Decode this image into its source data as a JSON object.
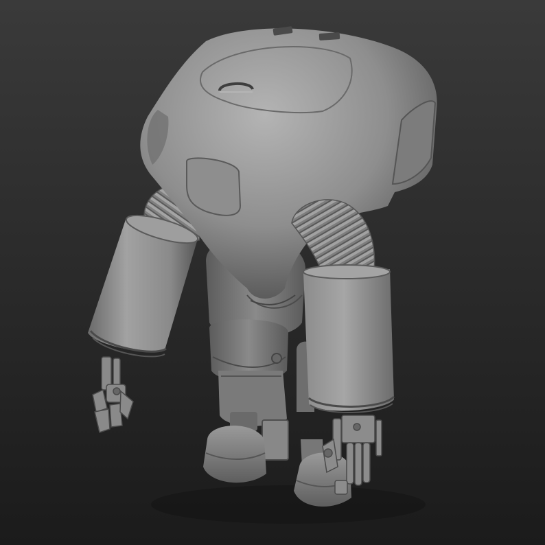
{
  "scene": {
    "subject": "sculpted-robot-render",
    "background_top": "#3a3a3a",
    "background_bottom": "#1b1b1b",
    "material_color": "#8a8a8a"
  }
}
